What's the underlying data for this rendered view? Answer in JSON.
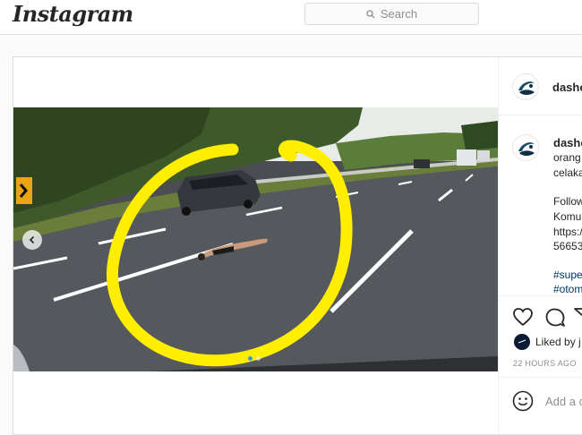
{
  "header": {
    "logo_text": "Instagram",
    "search_placeholder": "Search"
  },
  "post": {
    "username": "dashca",
    "caption_lines": [
      "orang",
      "celaka",
      "",
      "Follow",
      "Komun",
      "https:/",
      "56653"
    ],
    "hashtags": [
      "#supe",
      "#otom"
    ],
    "liked_by_text": "Liked by j",
    "timestamp": "22 HOURS AGO",
    "add_comment_placeholder": "Add a c",
    "carousel": {
      "total": 2,
      "current": 1
    }
  },
  "colors": {
    "accent": "#3897f0",
    "hashtag": "#003569",
    "annotation_circle": "#ffee00"
  },
  "icons": [
    "search-icon",
    "heart-icon",
    "comment-icon",
    "share-icon",
    "emoji-icon",
    "chevron-left-icon"
  ]
}
